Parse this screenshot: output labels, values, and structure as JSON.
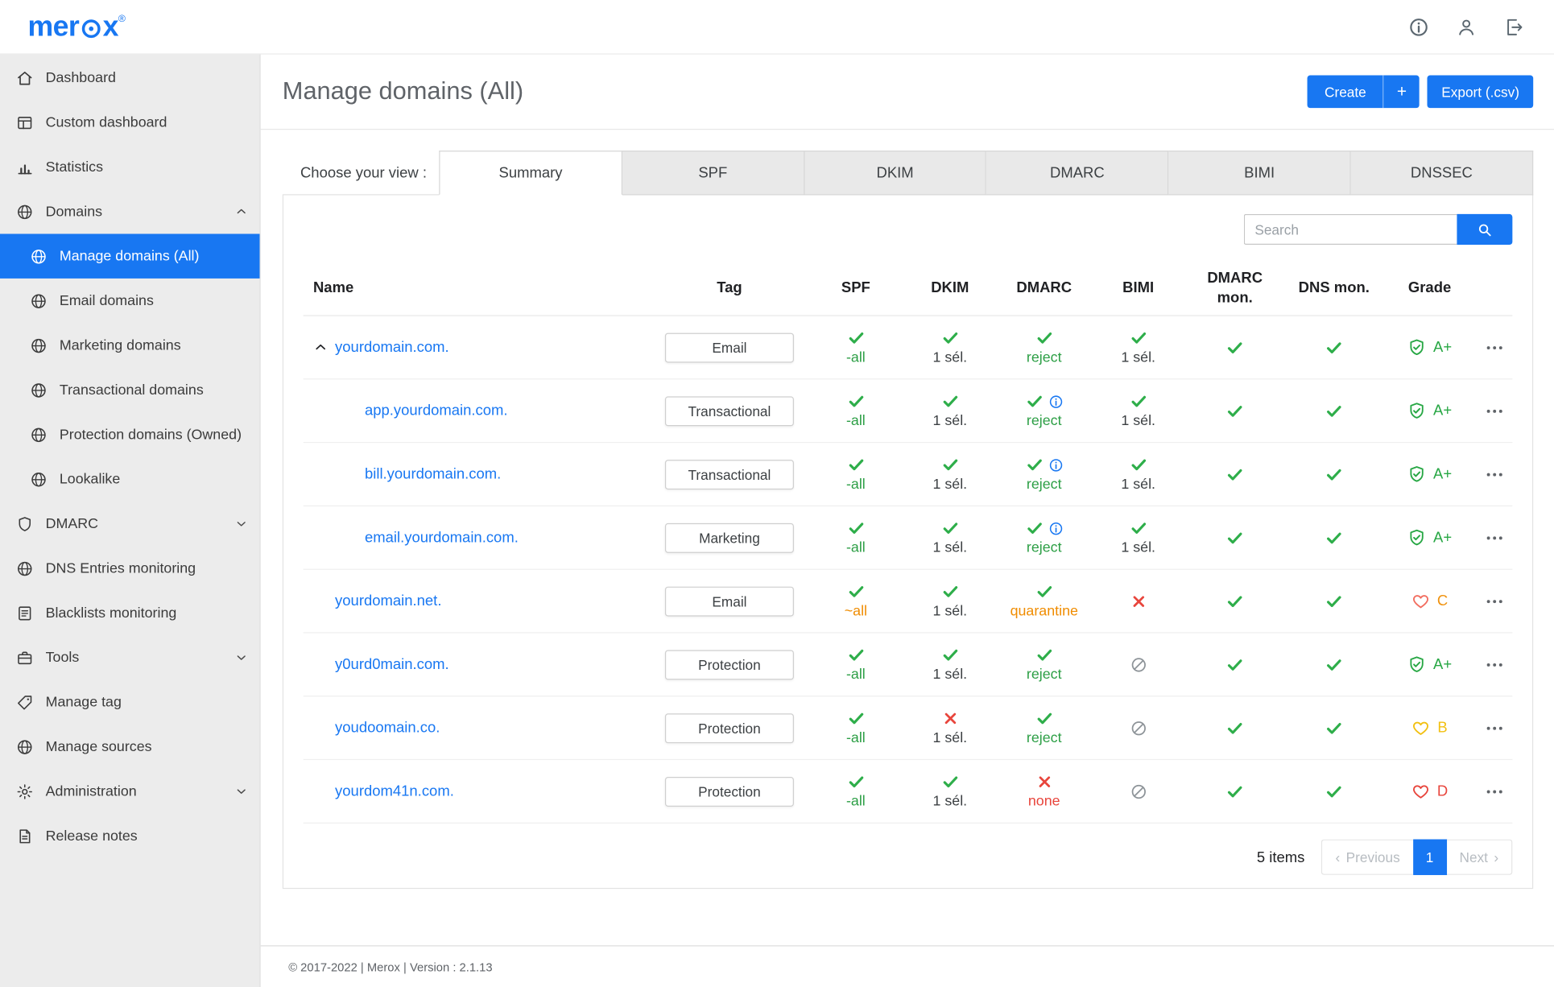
{
  "header": {
    "logo_prefix": "mer",
    "logo_suffix": "x",
    "logo_reg": "®",
    "icons": [
      "info-icon",
      "user-icon",
      "logout-icon"
    ]
  },
  "sidebar": {
    "items": [
      {
        "label": "Dashboard",
        "icon": "home"
      },
      {
        "label": "Custom dashboard",
        "icon": "dashboard"
      },
      {
        "label": "Statistics",
        "icon": "statistics"
      },
      {
        "label": "Domains",
        "icon": "globe",
        "chevron": "up"
      },
      {
        "label": "Manage domains (All)",
        "icon": "globe",
        "sub": true,
        "active": true
      },
      {
        "label": "Email domains",
        "icon": "globe",
        "sub": true
      },
      {
        "label": "Marketing domains",
        "icon": "globe",
        "sub": true
      },
      {
        "label": "Transactional domains",
        "icon": "globe",
        "sub": true
      },
      {
        "label": "Protection domains (Owned)",
        "icon": "globe",
        "sub": true
      },
      {
        "label": "Lookalike",
        "icon": "globe",
        "sub": true
      },
      {
        "label": "DMARC",
        "icon": "shield",
        "chevron": "down"
      },
      {
        "label": "DNS Entries monitoring",
        "icon": "globe"
      },
      {
        "label": "Blacklists monitoring",
        "icon": "list"
      },
      {
        "label": "Tools",
        "icon": "tools",
        "chevron": "down"
      },
      {
        "label": "Manage tag",
        "icon": "tag"
      },
      {
        "label": "Manage sources",
        "icon": "globe"
      },
      {
        "label": "Administration",
        "icon": "gear",
        "chevron": "down"
      },
      {
        "label": "Release notes",
        "icon": "notes"
      }
    ]
  },
  "page": {
    "title": "Manage domains (All)",
    "create_label": "Create",
    "create_plus": "+",
    "export_label": "Export (.csv)"
  },
  "view": {
    "label": "Choose your view :",
    "tabs": [
      {
        "label": "Summary",
        "active": true
      },
      {
        "label": "SPF"
      },
      {
        "label": "DKIM"
      },
      {
        "label": "DMARC"
      },
      {
        "label": "BIMI"
      },
      {
        "label": "DNSSEC"
      }
    ]
  },
  "search": {
    "placeholder": "Search"
  },
  "colors": {
    "primary_blue": "#1877f2",
    "check_green": "#2eae4a",
    "error_red": "#e8453c",
    "warn_orange": "#f08c00",
    "na_gray": "#8d9398"
  },
  "table": {
    "columns": [
      "Name",
      "Tag",
      "SPF",
      "DKIM",
      "DMARC",
      "BIMI",
      "DMARC mon.",
      "DNS mon.",
      "Grade"
    ],
    "rows": [
      {
        "name": "yourdomain.com.",
        "level": 0,
        "caret": true,
        "tag": "Email",
        "spf": {
          "icon": "check",
          "label": "-all",
          "label_color": "green"
        },
        "dkim": {
          "icon": "check",
          "label": "1 sél.",
          "label_color": "dark"
        },
        "dmarc": {
          "icon": "check",
          "info": false,
          "label": "reject",
          "label_color": "green"
        },
        "bimi": {
          "icon": "check",
          "label": "1 sél.",
          "label_color": "dark"
        },
        "dmarc_mon": {
          "icon": "check"
        },
        "dns_mon": {
          "icon": "check"
        },
        "grade": {
          "label": "A+",
          "icon": "shieldcheck",
          "icon_color": "#27a744",
          "label_color": "#27a744"
        }
      },
      {
        "name": "app.yourdomain.com.",
        "level": 1,
        "caret": false,
        "tag": "Transactional",
        "spf": {
          "icon": "check",
          "label": "-all",
          "label_color": "green"
        },
        "dkim": {
          "icon": "check",
          "label": "1 sél.",
          "label_color": "dark"
        },
        "dmarc": {
          "icon": "check",
          "info": true,
          "label": "reject",
          "label_color": "green"
        },
        "bimi": {
          "icon": "check",
          "label": "1 sél.",
          "label_color": "dark"
        },
        "dmarc_mon": {
          "icon": "check"
        },
        "dns_mon": {
          "icon": "check"
        },
        "grade": {
          "label": "A+",
          "icon": "shieldcheck",
          "icon_color": "#27a744",
          "label_color": "#27a744"
        }
      },
      {
        "name": "bill.yourdomain.com.",
        "level": 1,
        "caret": false,
        "tag": "Transactional",
        "spf": {
          "icon": "check",
          "label": "-all",
          "label_color": "green"
        },
        "dkim": {
          "icon": "check",
          "label": "1 sél.",
          "label_color": "dark"
        },
        "dmarc": {
          "icon": "check",
          "info": true,
          "label": "reject",
          "label_color": "green"
        },
        "bimi": {
          "icon": "check",
          "label": "1 sél.",
          "label_color": "dark"
        },
        "dmarc_mon": {
          "icon": "check"
        },
        "dns_mon": {
          "icon": "check"
        },
        "grade": {
          "label": "A+",
          "icon": "shieldcheck",
          "icon_color": "#27a744",
          "label_color": "#27a744"
        }
      },
      {
        "name": "email.yourdomain.com.",
        "level": 1,
        "caret": false,
        "tag": "Marketing",
        "spf": {
          "icon": "check",
          "label": "-all",
          "label_color": "green"
        },
        "dkim": {
          "icon": "check",
          "label": "1 sél.",
          "label_color": "dark"
        },
        "dmarc": {
          "icon": "check",
          "info": true,
          "label": "reject",
          "label_color": "green"
        },
        "bimi": {
          "icon": "check",
          "label": "1 sél.",
          "label_color": "dark"
        },
        "dmarc_mon": {
          "icon": "check"
        },
        "dns_mon": {
          "icon": "check"
        },
        "grade": {
          "label": "A+",
          "icon": "shieldcheck",
          "icon_color": "#27a744",
          "label_color": "#27a744"
        }
      },
      {
        "name": "yourdomain.net.",
        "level": 0,
        "caret": false,
        "tag": "Email",
        "spf": {
          "icon": "check",
          "label": "~all",
          "label_color": "orange"
        },
        "dkim": {
          "icon": "check",
          "label": "1 sél.",
          "label_color": "dark"
        },
        "dmarc": {
          "icon": "check",
          "info": false,
          "label": "quarantine",
          "label_color": "orange"
        },
        "bimi": {
          "icon": "x"
        },
        "dmarc_mon": {
          "icon": "check"
        },
        "dns_mon": {
          "icon": "check"
        },
        "grade": {
          "label": "C",
          "icon": "heart",
          "icon_color": "#f26d5f",
          "label_color": "#f0920e"
        }
      },
      {
        "name": "y0urd0main.com.",
        "level": 0,
        "caret": false,
        "tag": "Protection",
        "spf": {
          "icon": "check",
          "label": "-all",
          "label_color": "green"
        },
        "dkim": {
          "icon": "check",
          "label": "1 sél.",
          "label_color": "dark"
        },
        "dmarc": {
          "icon": "check",
          "info": false,
          "label": "reject",
          "label_color": "green"
        },
        "bimi": {
          "icon": "slash"
        },
        "dmarc_mon": {
          "icon": "check"
        },
        "dns_mon": {
          "icon": "check"
        },
        "grade": {
          "label": "A+",
          "icon": "shieldcheck",
          "icon_color": "#27a744",
          "label_color": "#27a744"
        }
      },
      {
        "name": "youdoomain.co.",
        "level": 0,
        "caret": false,
        "tag": "Protection",
        "spf": {
          "icon": "check",
          "label": "-all",
          "label_color": "green"
        },
        "dkim": {
          "icon": "x",
          "label": "1 sél.",
          "label_color": "dark"
        },
        "dmarc": {
          "icon": "check",
          "info": false,
          "label": "reject",
          "label_color": "green"
        },
        "bimi": {
          "icon": "slash"
        },
        "dmarc_mon": {
          "icon": "check"
        },
        "dns_mon": {
          "icon": "check"
        },
        "grade": {
          "label": "B",
          "icon": "heart",
          "icon_color": "#f2c012",
          "label_color": "#f2c012"
        }
      },
      {
        "name": "yourdom41n.com.",
        "level": 0,
        "caret": false,
        "tag": "Protection",
        "spf": {
          "icon": "check",
          "label": "-all",
          "label_color": "green"
        },
        "dkim": {
          "icon": "check",
          "label": "1 sél.",
          "label_color": "dark"
        },
        "dmarc": {
          "icon": "x",
          "info": false,
          "label": "none",
          "label_color": "red"
        },
        "bimi": {
          "icon": "slash"
        },
        "dmarc_mon": {
          "icon": "check"
        },
        "dns_mon": {
          "icon": "check"
        },
        "grade": {
          "label": "D",
          "icon": "heart",
          "icon_color": "#e8453c",
          "label_color": "#e8453c"
        }
      }
    ]
  },
  "pagination": {
    "items_label": "5 items",
    "prev_icon": "‹",
    "previous": "Previous",
    "page": "1",
    "next": "Next",
    "next_icon": "›"
  },
  "footer": {
    "text": "© 2017-2022 | Merox | Version : 2.1.13"
  }
}
